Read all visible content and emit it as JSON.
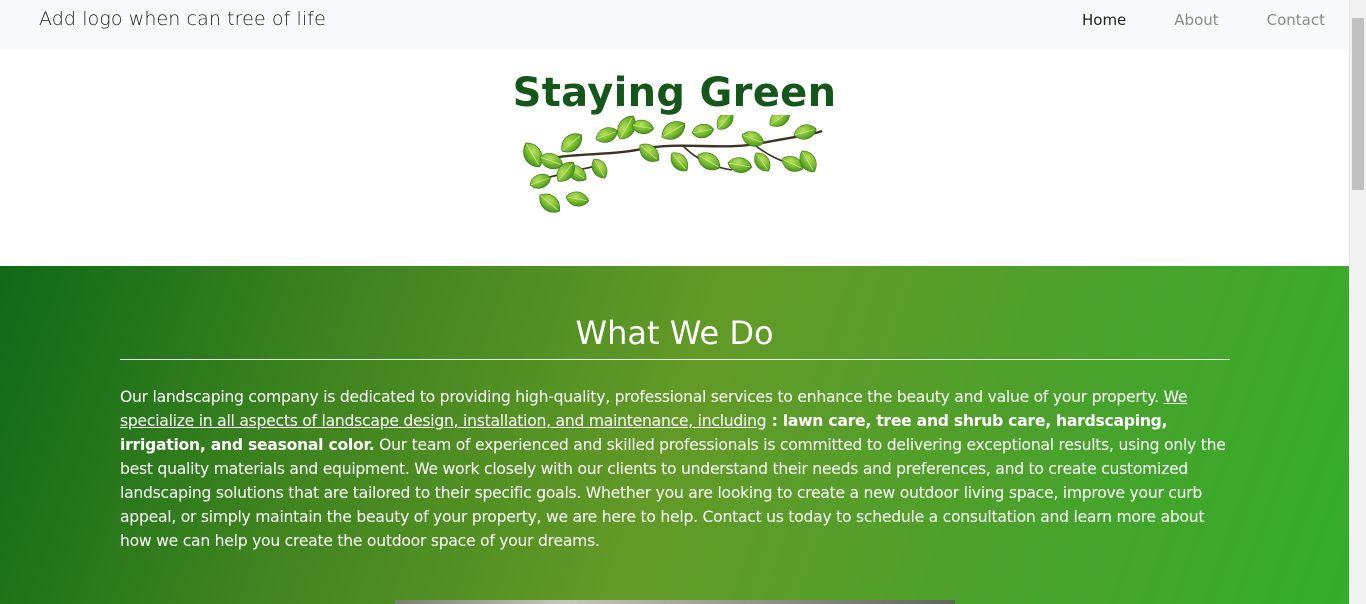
{
  "navbar": {
    "brand": "Add logo when can tree of life",
    "links": [
      {
        "label": "Home",
        "active": true
      },
      {
        "label": "About",
        "active": false
      },
      {
        "label": "Contact",
        "active": false
      }
    ]
  },
  "hero": {
    "title": "Staying Green",
    "image": "leafy-vine-branch"
  },
  "about": {
    "title": "What We Do",
    "intro": "Our landscaping company is dedicated to providing high-quality, professional services to enhance the beauty and value of your property. ",
    "link_text": "We specialize in all aspects of landscape design, installation, and maintenance, including",
    "bold_text": " : lawn care, tree and shrub care, hardscaping, irrigation, and seasonal color.",
    "rest": " Our team of experienced and skilled professionals is committed to delivering exceptional results, using only the best quality materials and equipment. We work closely with our clients to understand their needs and preferences, and to create customized landscaping solutions that are tailored to their specific goals. Whether you are looking to create a new outdoor living space, improve your curb appeal, or simply maintain the beauty of your property, we are here to help. Contact us today to schedule a consultation and learn more about how we can help you create the outdoor space of your dreams."
  },
  "colors": {
    "title_green": "#15561a",
    "gradient_start": "#0f6a17",
    "gradient_end": "#33ad2a",
    "navbar_bg": "#f8f9fa"
  }
}
